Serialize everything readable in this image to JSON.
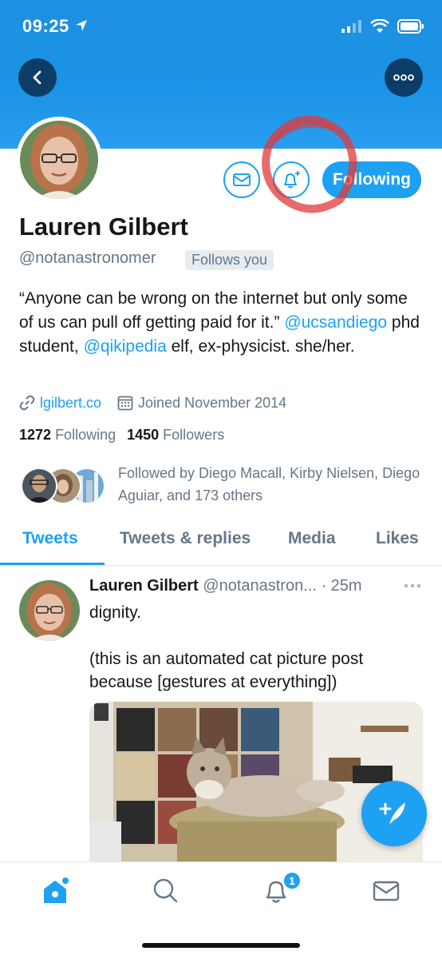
{
  "status_bar": {
    "time": "09:25"
  },
  "profile": {
    "name": "Lauren Gilbert",
    "handle": "@notanastronomer",
    "follows_you_label": "Follows you",
    "following_button": "Following",
    "bio_part1": "“Anyone can be wrong on the internet but only some of us can pull off getting paid for it.” ",
    "bio_link1": "@ucsandiego",
    "bio_part2": " phd student, ",
    "bio_link2": "@qikipedia",
    "bio_part3": " elf, ex-physicist. she/her.",
    "website": "lgilbert.co",
    "joined": "Joined November 2014",
    "following_count": "1272",
    "following_label": "Following",
    "followers_count": "1450",
    "followers_label": "Followers",
    "followed_by": "Followed by Diego Macall, Kirby Nielsen, Diego Aguiar, and 173 others"
  },
  "tabs": [
    {
      "label": "Tweets",
      "active": true
    },
    {
      "label": "Tweets & replies",
      "active": false
    },
    {
      "label": "Media",
      "active": false
    },
    {
      "label": "Likes",
      "active": false
    }
  ],
  "tweet": {
    "author": "Lauren Gilbert",
    "handle": "@notanastron...",
    "time": "· 25m",
    "line1": "dignity.",
    "line2": "(this is an automated cat picture post because [gestures at everything])"
  },
  "bottom_nav": {
    "notification_badge": "1",
    "icons": [
      "home-icon",
      "search-icon",
      "notifications-icon",
      "messages-icon"
    ]
  },
  "colors": {
    "brand_blue": "#1da1f2",
    "header_blue": "#1a94e6",
    "annotation_red": "#e03a3a"
  }
}
